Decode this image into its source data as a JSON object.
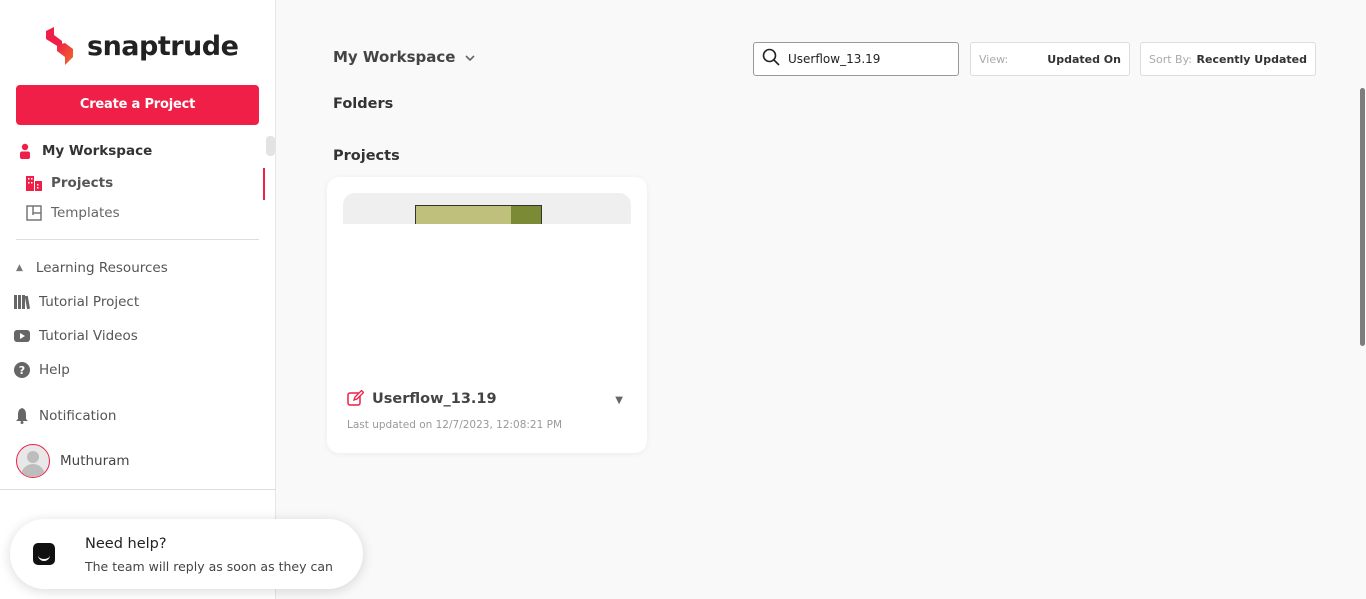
{
  "brand": {
    "name": "snaptrude",
    "accent": "#ef1f47"
  },
  "sidebar": {
    "create_label": "Create a Project",
    "workspace_label": "My Workspace",
    "projects_label": "Projects",
    "templates_label": "Templates",
    "learning_label": "Learning Resources",
    "tutorial_project_label": "Tutorial Project",
    "tutorial_videos_label": "Tutorial Videos",
    "help_label": "Help",
    "notification_label": "Notification",
    "user_name": "Muthuram"
  },
  "help_widget": {
    "title": "Need help?",
    "subtitle": "The team will reply as soon as they can"
  },
  "main": {
    "workspace_title": "My Workspace",
    "folders_title": "Folders",
    "projects_title": "Projects",
    "search_value": "Userflow_13.19",
    "view_label": "View:",
    "view_value": "Updated On",
    "sort_label": "Sort By:",
    "sort_value": "Recently Updated"
  },
  "projects": [
    {
      "name": "Userflow_13.19",
      "updated": "Last updated on 12/7/2023, 12:08:21 PM"
    }
  ]
}
